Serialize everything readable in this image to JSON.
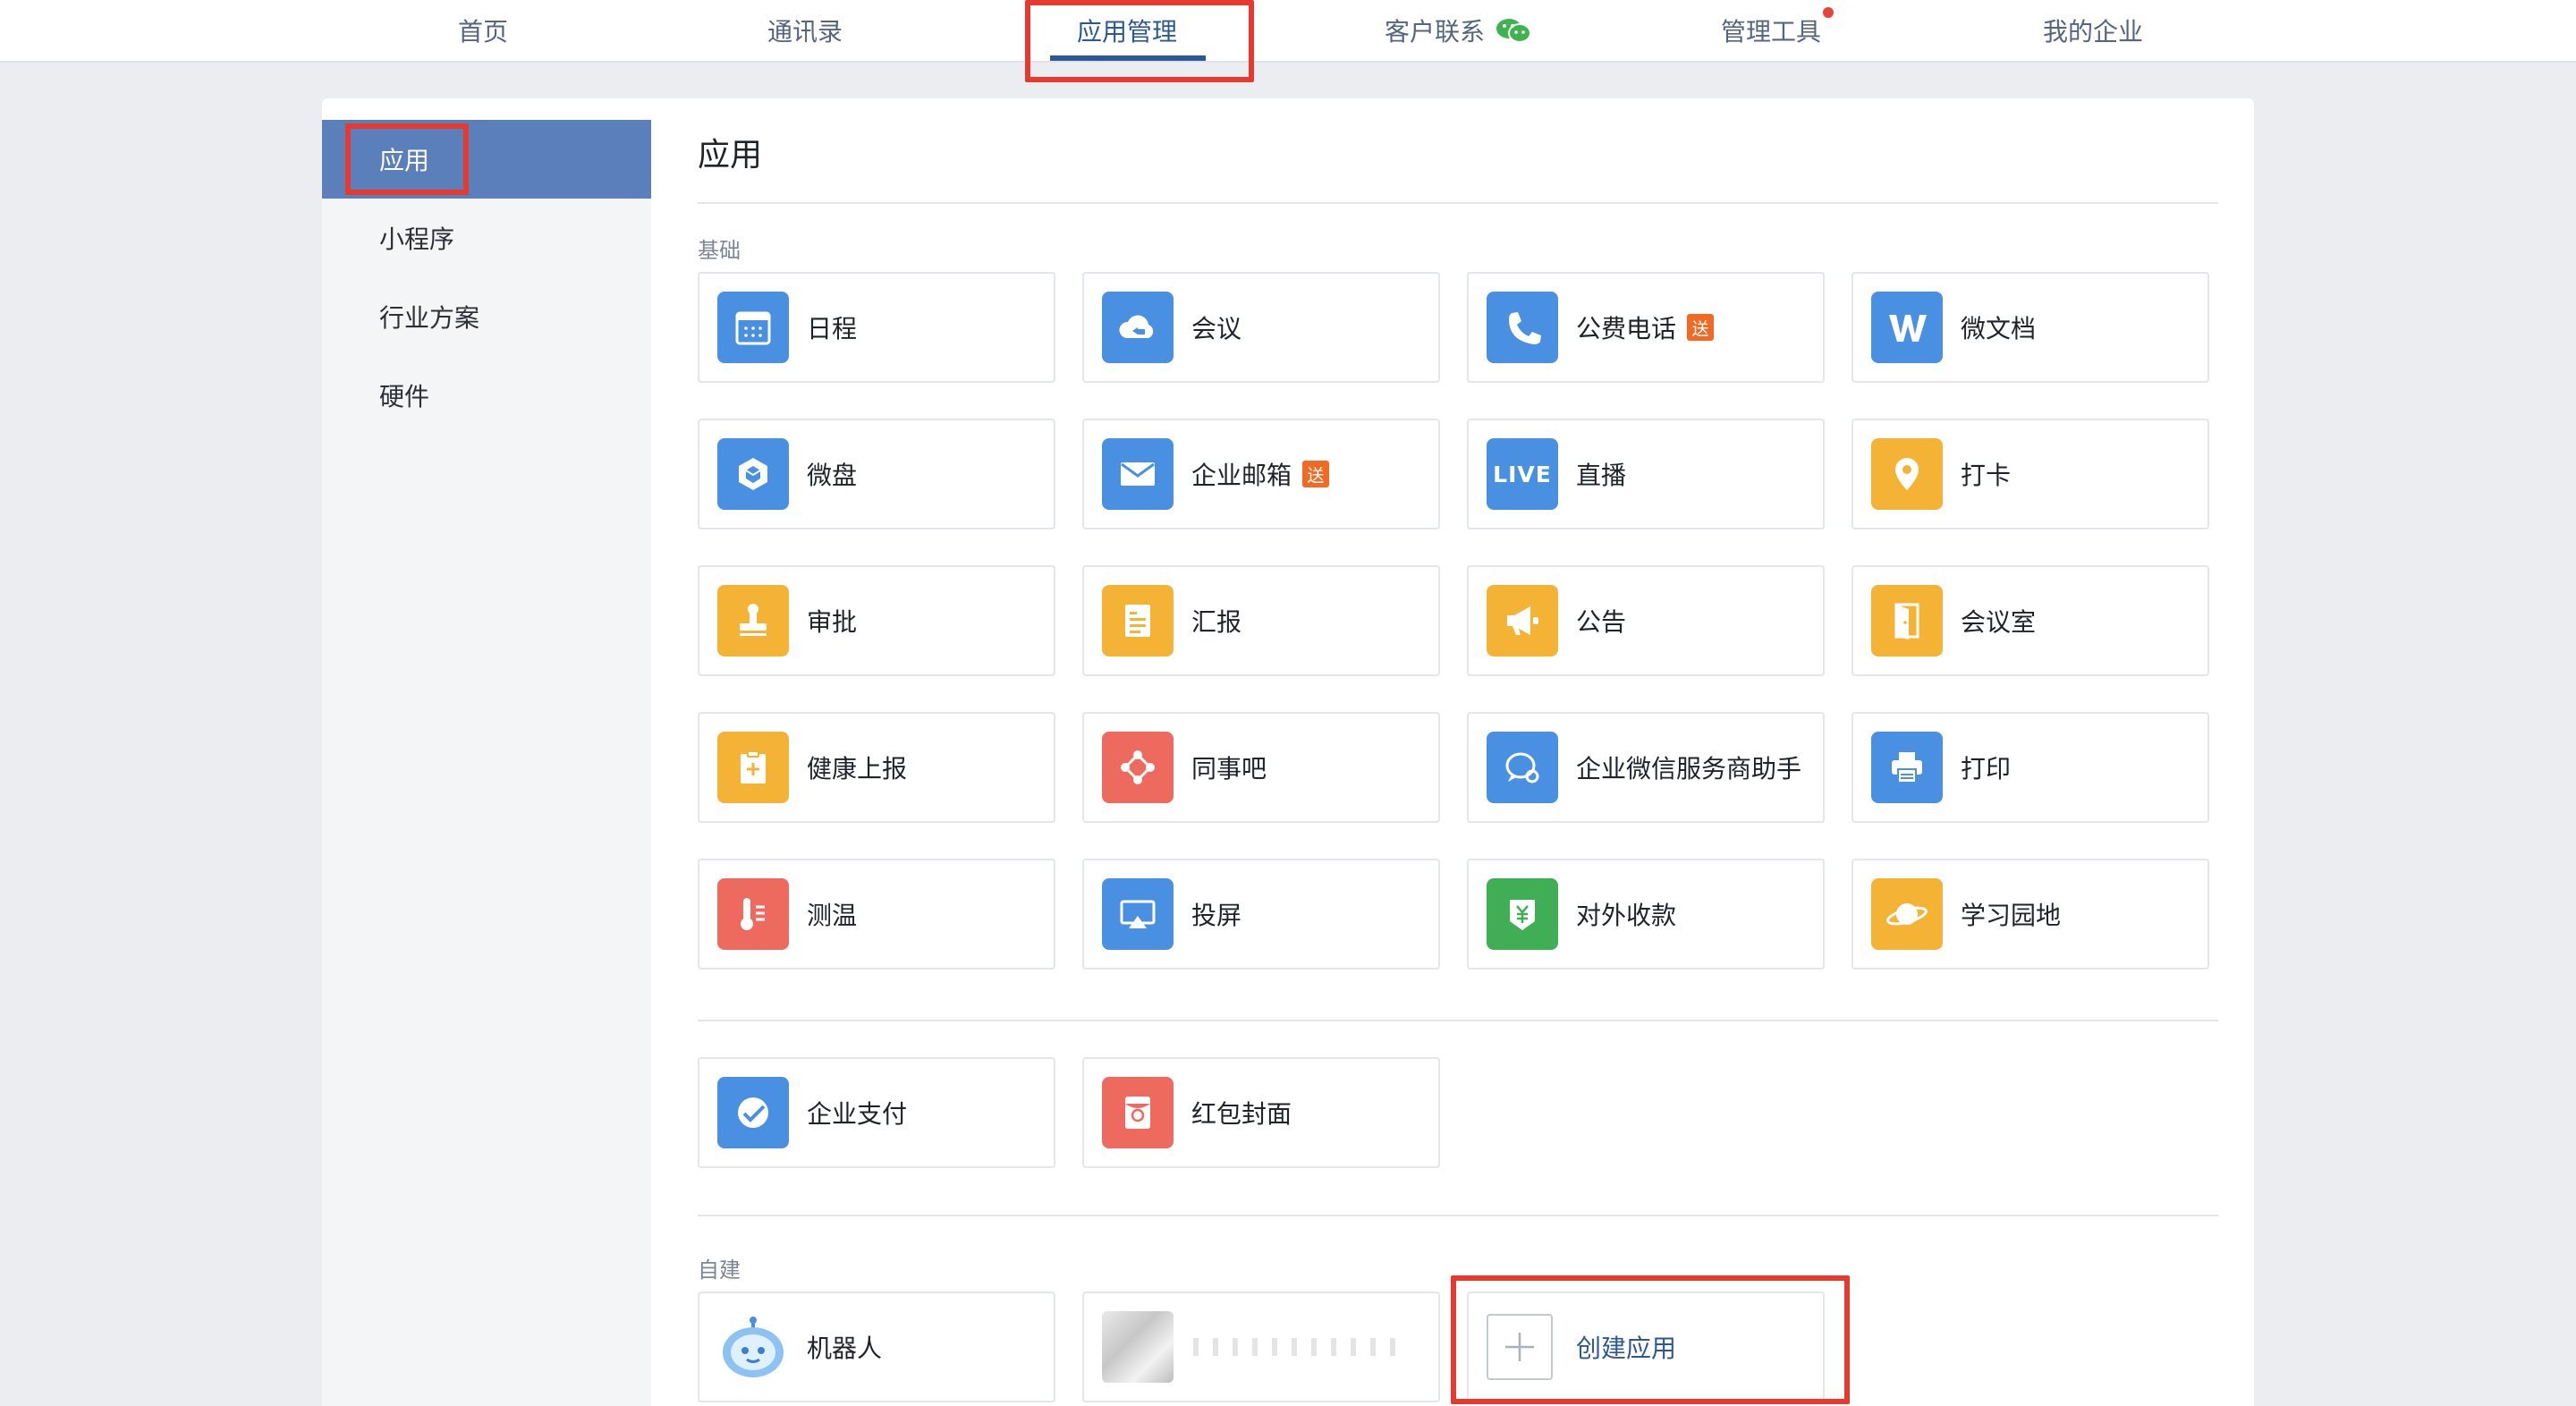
{
  "nav": {
    "items": [
      {
        "key": "home",
        "label": "首页"
      },
      {
        "key": "contacts",
        "label": "通讯录"
      },
      {
        "key": "apps",
        "label": "应用管理"
      },
      {
        "key": "customer",
        "label": "客户联系"
      },
      {
        "key": "tools",
        "label": "管理工具"
      },
      {
        "key": "company",
        "label": "我的企业"
      }
    ],
    "active": "应用管理"
  },
  "sidebar": {
    "items": [
      {
        "label": "应用",
        "active": true
      },
      {
        "label": "小程序"
      },
      {
        "label": "行业方案"
      },
      {
        "label": "硬件"
      }
    ]
  },
  "main": {
    "title": "应用",
    "section_basic": "基础",
    "section_custom": "自建",
    "badge": "送",
    "apps": [
      {
        "label": "日程",
        "icon": "calendar-icon",
        "color": "#4a90e2"
      },
      {
        "label": "会议",
        "icon": "cloud-meeting-icon",
        "color": "#4a90e2"
      },
      {
        "label": "公费电话",
        "icon": "phone-icon",
        "color": "#4a90e2",
        "badge": true
      },
      {
        "label": "微文档",
        "icon": "w-doc-icon",
        "color": "#4a90e2"
      },
      {
        "label": "微盘",
        "icon": "cube-drive-icon",
        "color": "#4a90e2"
      },
      {
        "label": "企业邮箱",
        "icon": "mail-icon",
        "color": "#4a90e2",
        "badge": true
      },
      {
        "label": "直播",
        "icon": "live-icon",
        "color": "#4a90e2",
        "text": "LIVE"
      },
      {
        "label": "打卡",
        "icon": "location-pin-icon",
        "color": "#f5b335"
      },
      {
        "label": "审批",
        "icon": "stamp-icon",
        "color": "#f5b335"
      },
      {
        "label": "汇报",
        "icon": "report-icon",
        "color": "#f5b335"
      },
      {
        "label": "公告",
        "icon": "megaphone-icon",
        "color": "#f5b335"
      },
      {
        "label": "会议室",
        "icon": "door-icon",
        "color": "#f5b335"
      },
      {
        "label": "健康上报",
        "icon": "clipboard-plus-icon",
        "color": "#f5b335"
      },
      {
        "label": "同事吧",
        "icon": "network-icon",
        "color": "#ef6a5e"
      },
      {
        "label": "企业微信服务商助手",
        "icon": "chat-bubbles-icon",
        "color": "#4a90e2"
      },
      {
        "label": "打印",
        "icon": "printer-icon",
        "color": "#4a90e2"
      },
      {
        "label": "测温",
        "icon": "thermometer-icon",
        "color": "#ef6a5e"
      },
      {
        "label": "投屏",
        "icon": "screen-cast-icon",
        "color": "#4a90e2"
      },
      {
        "label": "对外收款",
        "icon": "payment-shield-icon",
        "color": "#3fae55"
      },
      {
        "label": "学习园地",
        "icon": "planet-icon",
        "color": "#f5b335"
      }
    ],
    "apps2": [
      {
        "label": "企业支付",
        "icon": "pay-check-icon",
        "color": "#4a90e2"
      },
      {
        "label": "红包封面",
        "icon": "red-envelope-icon",
        "color": "#ef6a5e"
      }
    ],
    "custom": [
      {
        "label": "机器人",
        "icon": "robot-icon"
      },
      {
        "label": "",
        "icon": "blurred-app-icon"
      }
    ],
    "create_label": "创建应用"
  }
}
